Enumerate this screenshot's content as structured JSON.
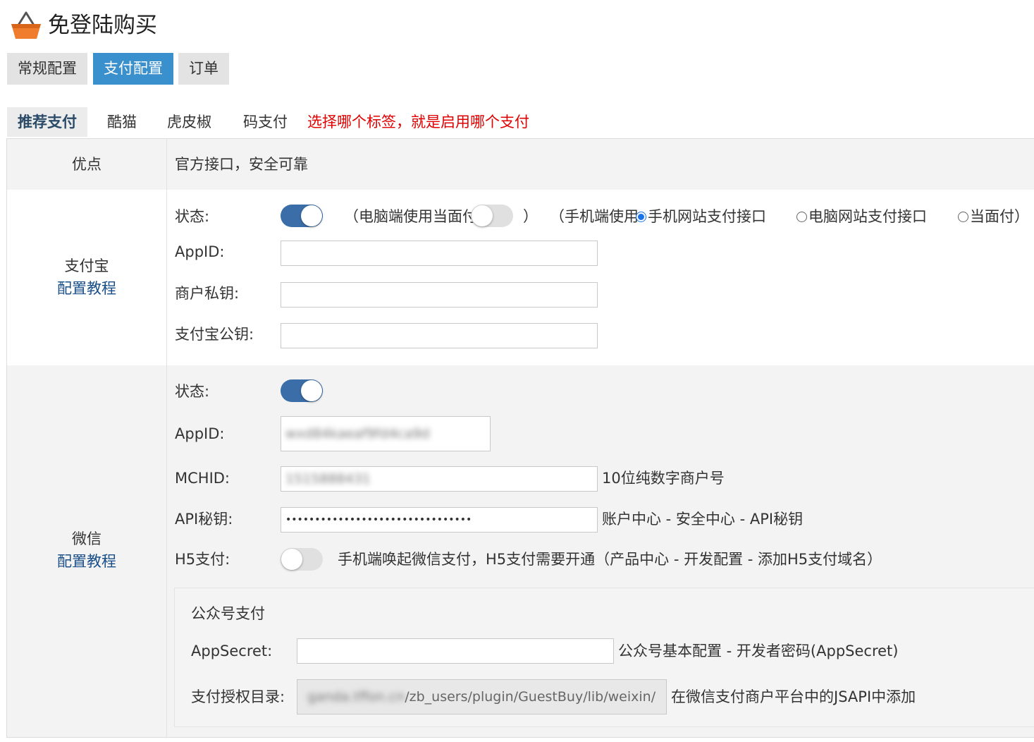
{
  "header": {
    "title": "免登陆购买",
    "logo_icon": "basket-icon"
  },
  "top_tabs": [
    "常规配置",
    "支付配置",
    "订单"
  ],
  "sub_tabs": [
    "推荐支付",
    "酷猫",
    "虎皮椒",
    "码支付"
  ],
  "sub_tip": "选择哪个标签，就是启用哪个支付",
  "advantage": {
    "label": "优点",
    "value": "官方接口，安全可靠"
  },
  "alipay": {
    "name": "支付宝",
    "tutorial": "配置教程",
    "status_label": "状态:",
    "status_on": true,
    "pc_paren_open": "（电脑端使用当面付",
    "pc_face_pay_on": false,
    "pc_paren_close": "）",
    "mobile_prefix": "（手机端使用",
    "mobile_options": [
      "手机网站支付接口",
      "电脑网站支付接口",
      "当面付）"
    ],
    "mobile_selected": 0,
    "appid_label": "AppID:",
    "appid_value": "",
    "private_key_label": "商户私钥:",
    "private_key_value": "",
    "public_key_label": "支付宝公钥:",
    "public_key_value": ""
  },
  "wechat": {
    "name": "微信",
    "tutorial": "配置教程",
    "status_label": "状态:",
    "status_on": true,
    "appid_label": "AppID:",
    "appid_value": "wxd84kaeaf9fd4ca9d",
    "mchid_label": "MCHID:",
    "mchid_value": "1515888431",
    "mchid_hint": "10位纯数字商户号",
    "apikey_label": "API秘钥:",
    "apikey_value": "••••••••••••••••••••••••••••••••",
    "apikey_hint": "账户中心 - 安全中心 - API秘钥",
    "h5_label": "H5支付:",
    "h5_on": false,
    "h5_hint": "手机端唤起微信支付，H5支付需要开通（产品中心 - 开发配置 - 添加H5支付域名）",
    "mp": {
      "title": "公众号支付",
      "appsecret_label": "AppSecret:",
      "appsecret_value": "",
      "appsecret_hint": "公众号基本配置 - 开发者密码(AppSecret)",
      "authdir_label": "支付授权目录:",
      "authdir_blurred": "ganda.tffon.cn",
      "authdir_path": "/zb_users/plugin/GuestBuy/lib/weixin/",
      "authdir_hint": "在微信支付商户平台中的JSAPI中添加"
    }
  },
  "colors": {
    "accent": "#3a8fcd",
    "toggle_on": "#3b6ea8",
    "tip_red": "#e00000",
    "link": "#1a4f8a"
  }
}
